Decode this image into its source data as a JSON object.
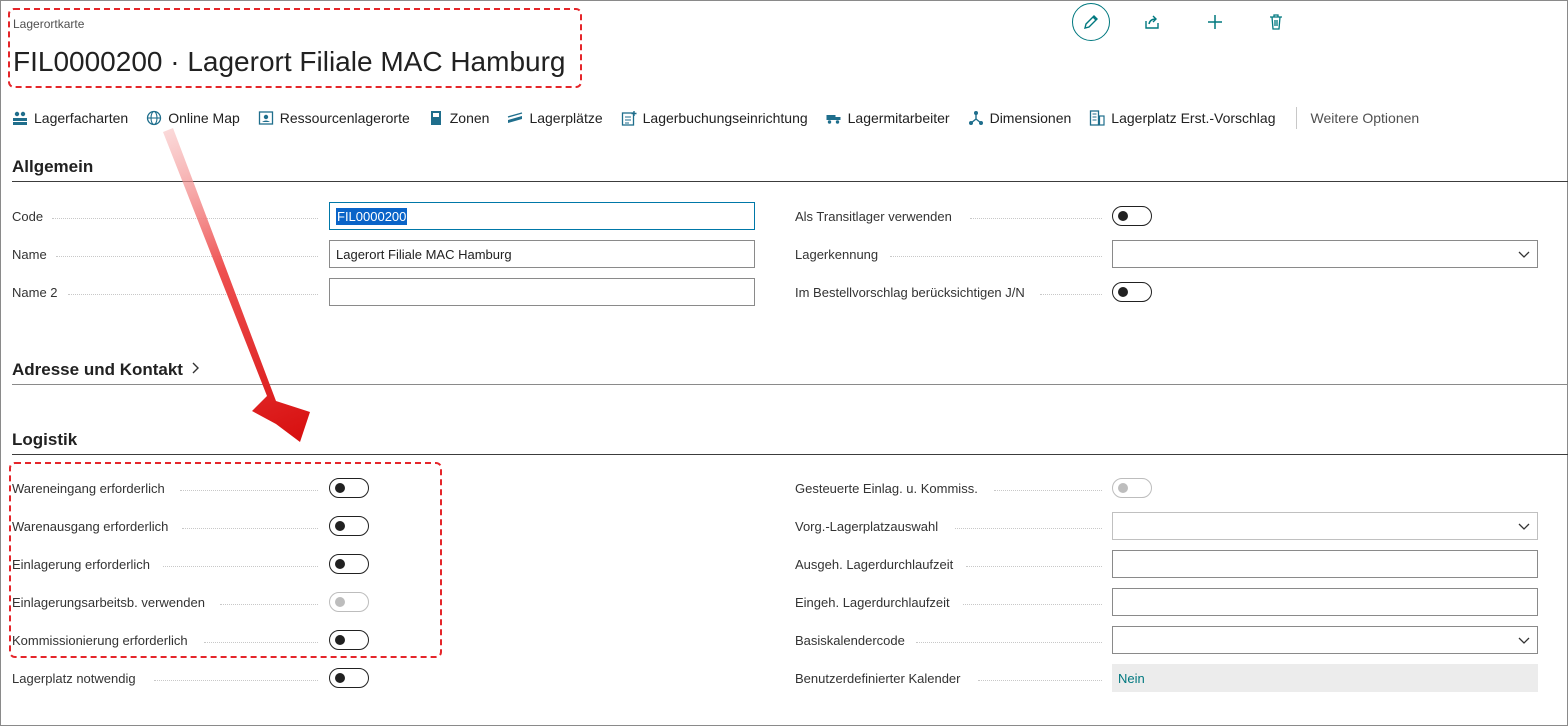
{
  "header": {
    "caption": "Lagerortkarte",
    "title": "FIL0000200 · Lagerort Filiale MAC Hamburg",
    "buttons": [
      "edit",
      "share",
      "new",
      "delete"
    ]
  },
  "actions": {
    "items": [
      {
        "label": "Lagerfacharten",
        "icon": "bins-icon"
      },
      {
        "label": "Online Map",
        "icon": "globe-icon"
      },
      {
        "label": "Ressourcenlagerorte",
        "icon": "resource-icon"
      },
      {
        "label": "Zonen",
        "icon": "zone-icon"
      },
      {
        "label": "Lagerplätze",
        "icon": "bin-icon"
      },
      {
        "label": "Lagerbuchungseinrichtung",
        "icon": "setup-icon"
      },
      {
        "label": "Lagermitarbeiter",
        "icon": "employee-icon"
      },
      {
        "label": "Dimensionen",
        "icon": "dimension-icon"
      },
      {
        "label": "Lagerplatz Erst.-Vorschlag",
        "icon": "worksheet-icon"
      }
    ],
    "more": "Weitere Optionen"
  },
  "general": {
    "title": "Allgemein",
    "code_label": "Code",
    "code_value": "FIL0000200",
    "name_label": "Name",
    "name_value": "Lagerort Filiale MAC Hamburg",
    "name2_label": "Name 2",
    "name2_value": "",
    "transit_label": "Als Transitlager verwenden",
    "lagerkennung_label": "Lagerkennung",
    "lagerkennung_value": "",
    "bestell_label": "Im Bestellvorschlag berücksichtigen J/N"
  },
  "address": {
    "title": "Adresse und Kontakt"
  },
  "logistics": {
    "title": "Logistik",
    "left": [
      {
        "label": "Wareneingang erforderlich",
        "on": false,
        "disabled": false
      },
      {
        "label": "Warenausgang erforderlich",
        "on": false,
        "disabled": false
      },
      {
        "label": "Einlagerung erforderlich",
        "on": false,
        "disabled": false
      },
      {
        "label": "Einlagerungsarbeitsb. verwenden",
        "on": false,
        "disabled": true
      },
      {
        "label": "Kommissionierung erforderlich",
        "on": false,
        "disabled": false
      },
      {
        "label": "Lagerplatz notwendig",
        "on": false,
        "disabled": false
      }
    ],
    "gesteuerte_label": "Gesteuerte Einlag. u. Kommiss.",
    "vorg_label": "Vorg.-Lagerplatzauswahl",
    "vorg_value": "",
    "ausgeh_label": "Ausgeh. Lagerdurchlaufzeit",
    "ausgeh_value": "",
    "eingeh_label": "Eingeh. Lagerdurchlaufzeit",
    "eingeh_value": "",
    "basiskal_label": "Basiskalendercode",
    "basiskal_value": "",
    "benutzer_label": "Benutzerdefinierter Kalender",
    "benutzer_value": "Nein"
  },
  "colors": {
    "accent": "#00787f",
    "highlight": "#e5252a",
    "selection": "#0a64c8"
  }
}
